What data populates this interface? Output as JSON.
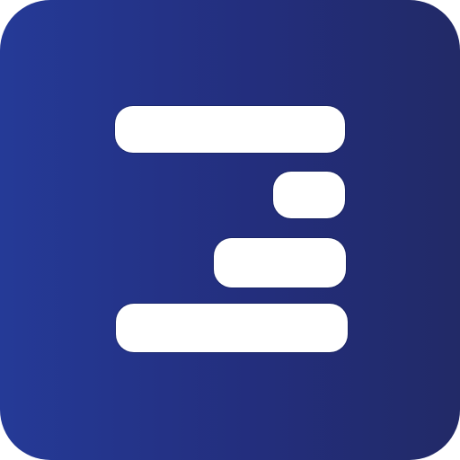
{
  "icon": {
    "name": "app-logo-icon",
    "colors": {
      "gradient_start": "#253a97",
      "gradient_end": "#222a67",
      "bars": "#ffffff"
    }
  }
}
